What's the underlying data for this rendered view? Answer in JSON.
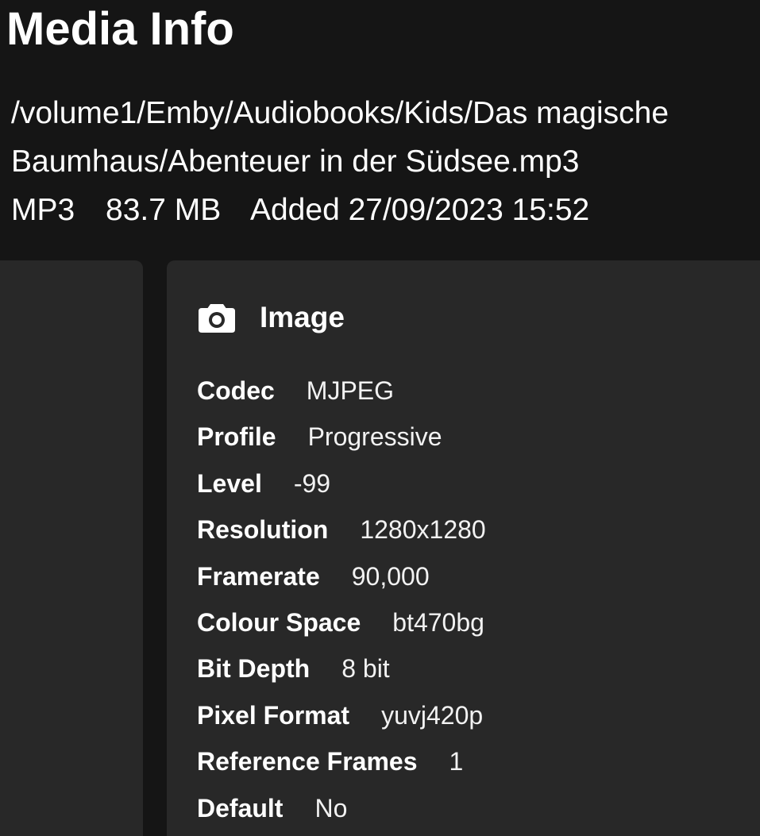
{
  "header": {
    "title": "Media Info",
    "path": "/volume1/Emby/Audiobooks/Kids/Das magische Baumhaus/Abenteuer in der Südsee.mp3",
    "format": "MP3",
    "size": "83.7 MB",
    "added": "Added 27/09/2023 15:52"
  },
  "stream": {
    "icon": "camera-icon",
    "title": "Image",
    "properties": [
      {
        "label": "Codec",
        "value": "MJPEG"
      },
      {
        "label": "Profile",
        "value": "Progressive"
      },
      {
        "label": "Level",
        "value": "-99"
      },
      {
        "label": "Resolution",
        "value": "1280x1280"
      },
      {
        "label": "Framerate",
        "value": "90,000"
      },
      {
        "label": "Colour Space",
        "value": "bt470bg"
      },
      {
        "label": "Bit Depth",
        "value": "8 bit"
      },
      {
        "label": "Pixel Format",
        "value": "yuvj420p"
      },
      {
        "label": "Reference Frames",
        "value": "1"
      },
      {
        "label": "Default",
        "value": "No"
      }
    ]
  },
  "colors": {
    "background": "#151515",
    "card": "#282828",
    "text": "#ffffff"
  }
}
